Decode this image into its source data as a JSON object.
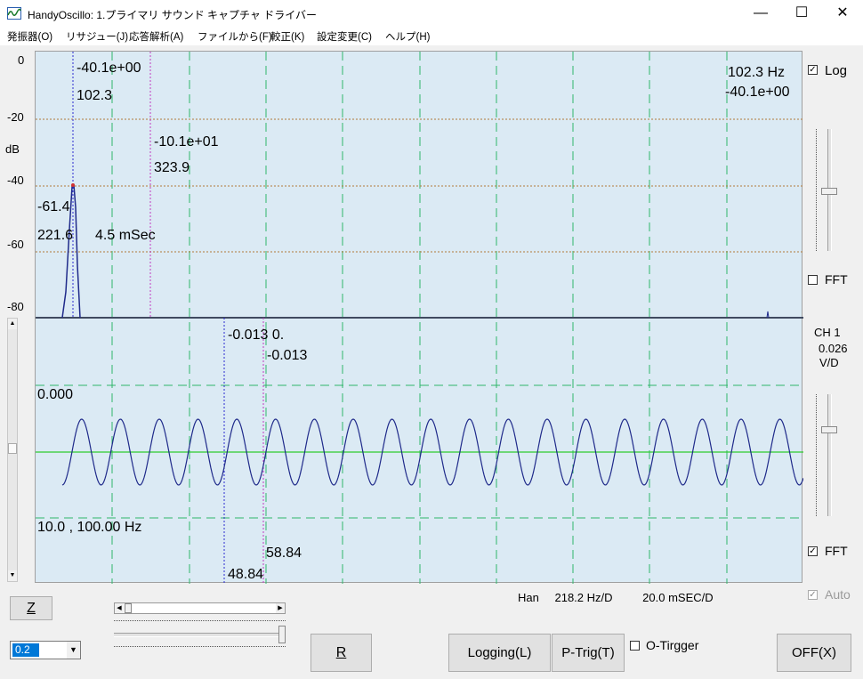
{
  "window": {
    "title": "HandyOscillo:  1.プライマリ サウンド キャプチャ ドライバー",
    "minimize": "—",
    "maximize": "☐",
    "close": "✕"
  },
  "menu": [
    {
      "label": "発振器(O)"
    },
    {
      "label": "リサジュー(J)"
    },
    {
      "label": "応答解析(A)"
    },
    {
      "label": "ファイルから(F)"
    },
    {
      "label": "較正(K)"
    },
    {
      "label": "設定変更(C)"
    },
    {
      "label": "ヘルプ(H)"
    }
  ],
  "spectrum": {
    "y_ticks": [
      "0",
      "-20",
      "-40",
      "-60",
      "-80"
    ],
    "unit": "dB",
    "cursor1": {
      "value": "-40.1e+00",
      "freq": "102.3"
    },
    "cursor2": {
      "value": "-10.1e+01",
      "freq": "323.9"
    },
    "peak": {
      "value": "-61.4",
      "freq": "221.6",
      "time": "4.5 mSec"
    },
    "readout": {
      "freq": "102.3 Hz",
      "value": "-40.1e+00"
    }
  },
  "waveform": {
    "cursor_readout_top": "-0.013    0.",
    "cursor_readout_2": "-0.013",
    "offset": "0.000",
    "signal": "10.0 , 100.00 Hz",
    "cursor2_x": "58.84",
    "cursor1_x": "48.84"
  },
  "right_panel": {
    "log_label": "Log",
    "log_checked": true,
    "fft_top_label": "FFT",
    "fft_top_checked": false,
    "ch_label": "CH 1",
    "vd_value": "0.026",
    "vd_unit": "V/D",
    "fft_bottom_label": "FFT",
    "fft_bottom_checked": true,
    "auto_label": "Auto",
    "auto_checked": true
  },
  "status": {
    "window_fn": "Han",
    "hz_per_div": "218.2 Hz/D",
    "msec_per_div": "20.0  mSEC/D"
  },
  "controls": {
    "z_button": "Z",
    "gain_select": "0.2",
    "r_button": "R",
    "logging_button": "Logging(L)",
    "ptrig_button": "P-Trig(T)",
    "otrigger_label": "O-Tirgger",
    "otrigger_checked": false,
    "off_button": "OFF(X)"
  },
  "colors": {
    "plot_bg": "#dbeaf4",
    "grid_green": "#2fb56a",
    "grid_brown": "#b07a3a",
    "trace": "#1f2a8a",
    "zero_line": "#2ecc2e",
    "cursor1": "#2b2bd0",
    "cursor2": "#c03ac0"
  }
}
